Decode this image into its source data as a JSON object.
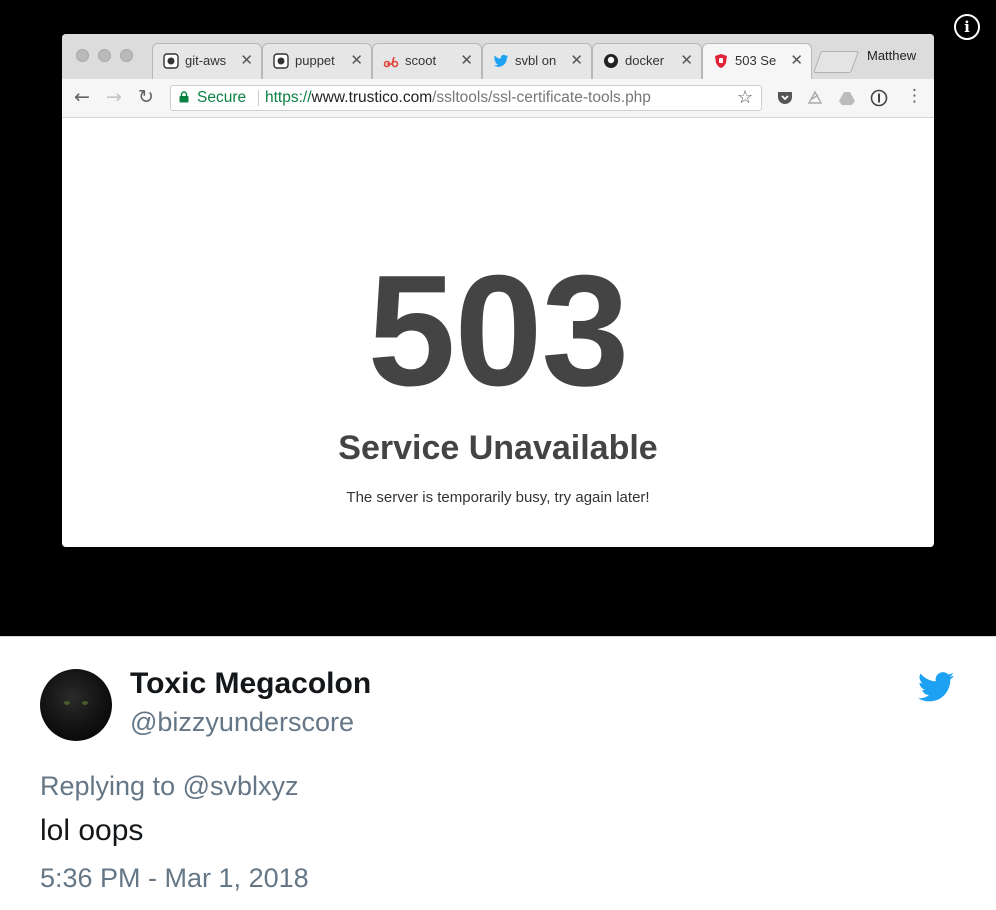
{
  "browser": {
    "tabs": [
      {
        "label": "git-aws",
        "icon": "github-icon",
        "active": false
      },
      {
        "label": "puppet",
        "icon": "github-icon",
        "active": false
      },
      {
        "label": "scoot",
        "icon": "scoot-icon",
        "active": false
      },
      {
        "label": "svbl on",
        "icon": "twitter-icon",
        "active": false
      },
      {
        "label": "docker",
        "icon": "github-icon",
        "active": false
      },
      {
        "label": "503 Se",
        "icon": "shield-icon",
        "active": true
      }
    ],
    "close_glyph": "✕",
    "profile_name": "Matthew",
    "address_bar": {
      "secure_label": "Secure",
      "url_scheme": "https://",
      "url_host": "www.trustico.com",
      "url_path": "/ssltools/ssl-certificate-tools.php"
    }
  },
  "error_page": {
    "code": "503",
    "title": "Service Unavailable",
    "message": "The server is temporarily busy, try again later!"
  },
  "tweet": {
    "display_name": "Toxic Megacolon",
    "handle": "@bizzyunderscore",
    "replying_prefix": "Replying to ",
    "replying_to": "@svblxyz",
    "text": "lol oops",
    "timestamp": "5:36 PM - Mar 1, 2018"
  },
  "colors": {
    "twitter_blue": "#1da1f2",
    "secure_green": "#0b8043",
    "error_text": "#444444"
  }
}
